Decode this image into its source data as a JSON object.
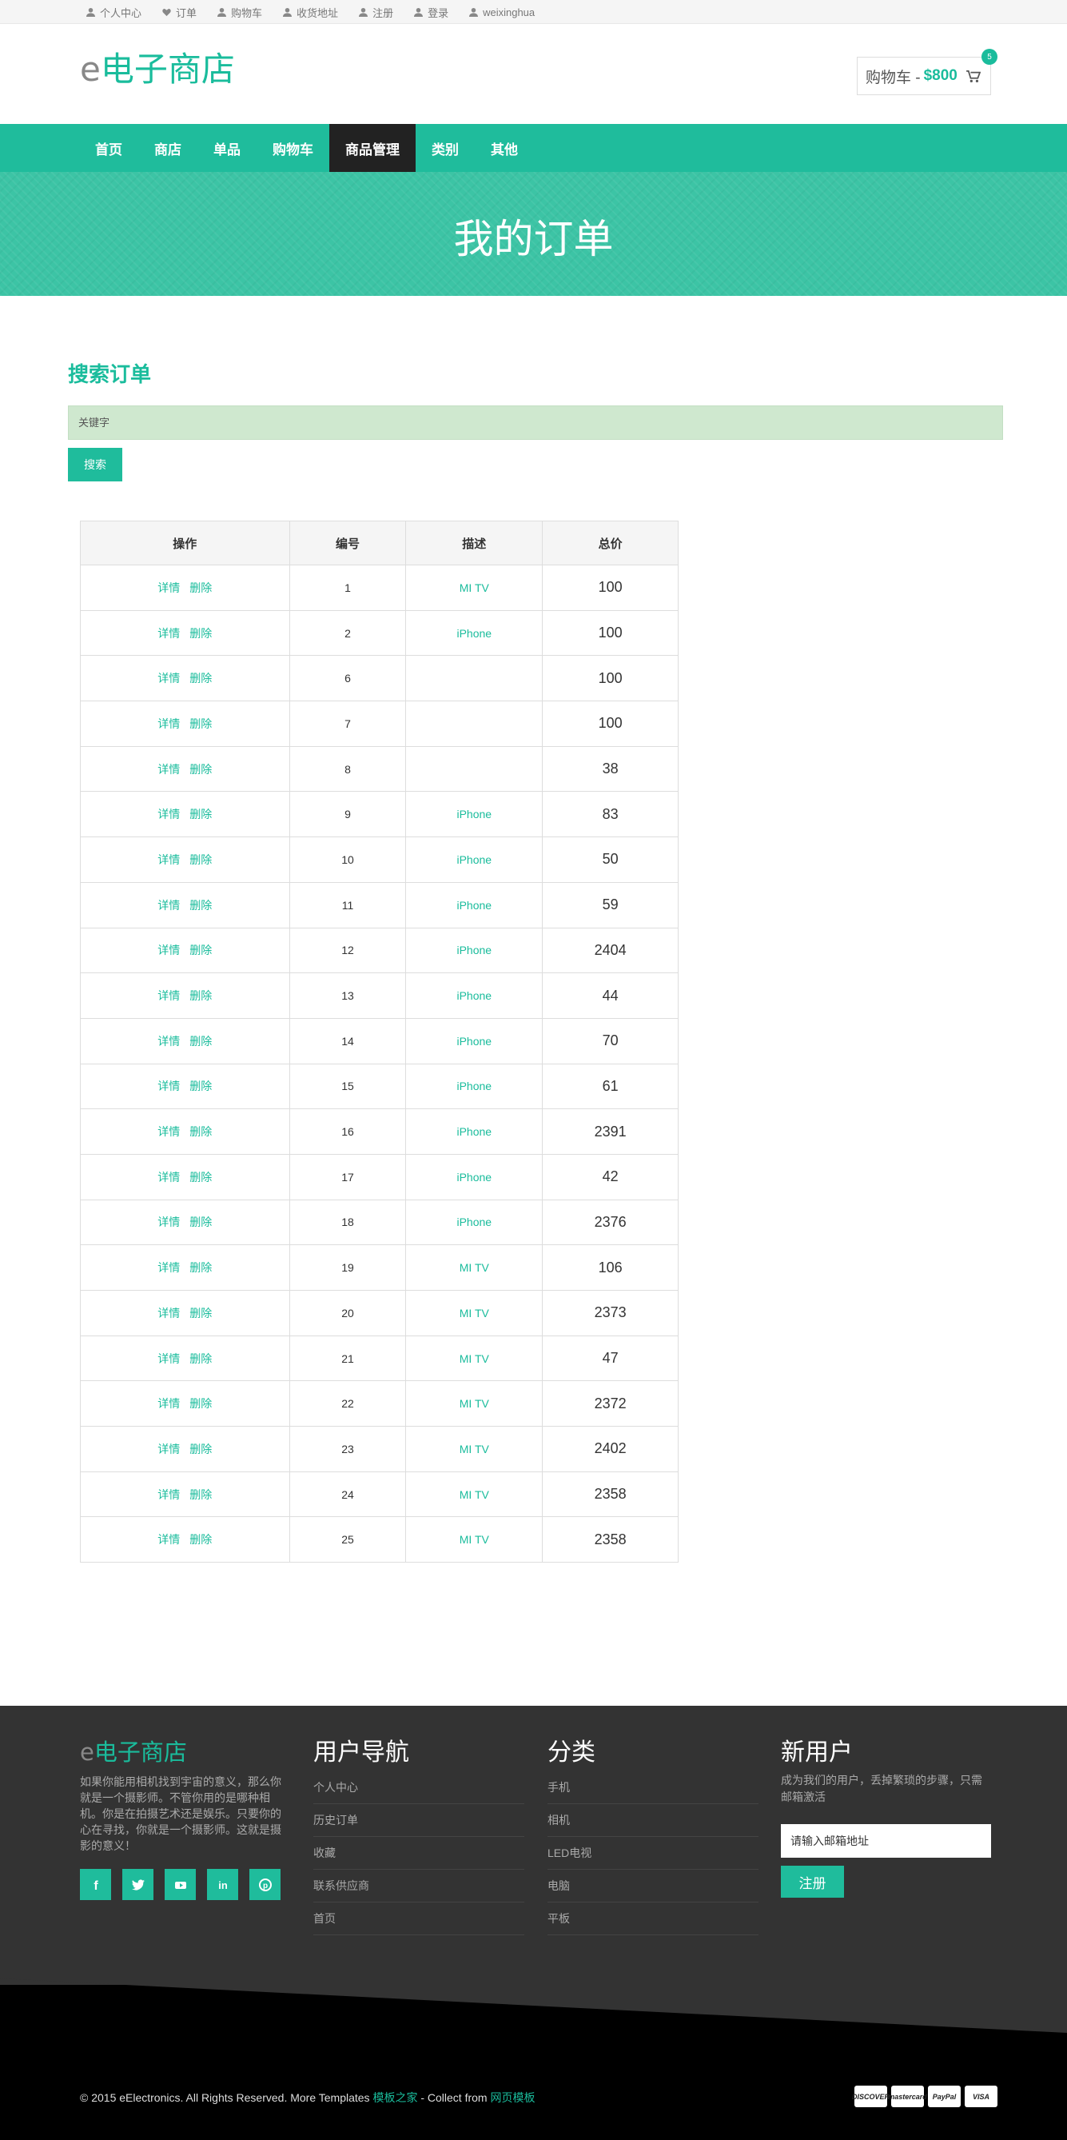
{
  "topbar": {
    "items": [
      {
        "label": "个人中心",
        "icon": "user-icon"
      },
      {
        "label": "订单",
        "icon": "heart-icon"
      },
      {
        "label": "购物车",
        "icon": "user-icon"
      },
      {
        "label": "收货地址",
        "icon": "user-icon"
      },
      {
        "label": "注册",
        "icon": "user-icon"
      },
      {
        "label": "登录",
        "icon": "user-icon"
      },
      {
        "label": "weixinghua",
        "icon": "user-icon"
      }
    ]
  },
  "header": {
    "logo_e": "e",
    "logo_text": "电子商店",
    "cart_label": "购物车 -",
    "cart_amount": "$800",
    "cart_count": "5"
  },
  "nav": {
    "items": [
      "首页",
      "商店",
      "单品",
      "购物车",
      "商品管理",
      "类别",
      "其他"
    ],
    "active": "商品管理"
  },
  "banner": {
    "title": "我的订单"
  },
  "search": {
    "title": "搜索订单",
    "placeholder": "关键字",
    "button": "搜索"
  },
  "table": {
    "headers": [
      "操作",
      "编号",
      "描述",
      "总价"
    ],
    "detail_label": "详情",
    "delete_label": "删除",
    "rows": [
      {
        "id": "1",
        "desc": "MI TV",
        "total": "100"
      },
      {
        "id": "2",
        "desc": "iPhone",
        "total": "100"
      },
      {
        "id": "6",
        "desc": "",
        "total": "100"
      },
      {
        "id": "7",
        "desc": "",
        "total": "100"
      },
      {
        "id": "8",
        "desc": "",
        "total": "38"
      },
      {
        "id": "9",
        "desc": "iPhone",
        "total": "83"
      },
      {
        "id": "10",
        "desc": "iPhone",
        "total": "50"
      },
      {
        "id": "11",
        "desc": "iPhone",
        "total": "59"
      },
      {
        "id": "12",
        "desc": "iPhone",
        "total": "2404"
      },
      {
        "id": "13",
        "desc": "iPhone",
        "total": "44"
      },
      {
        "id": "14",
        "desc": "iPhone",
        "total": "70"
      },
      {
        "id": "15",
        "desc": "iPhone",
        "total": "61"
      },
      {
        "id": "16",
        "desc": "iPhone",
        "total": "2391"
      },
      {
        "id": "17",
        "desc": "iPhone",
        "total": "42"
      },
      {
        "id": "18",
        "desc": "iPhone",
        "total": "2376"
      },
      {
        "id": "19",
        "desc": "MI TV",
        "total": "106"
      },
      {
        "id": "20",
        "desc": "MI TV",
        "total": "2373"
      },
      {
        "id": "21",
        "desc": "MI TV",
        "total": "47"
      },
      {
        "id": "22",
        "desc": "MI TV",
        "total": "2372"
      },
      {
        "id": "23",
        "desc": "MI TV",
        "total": "2402"
      },
      {
        "id": "24",
        "desc": "MI TV",
        "total": "2358"
      },
      {
        "id": "25",
        "desc": "MI TV",
        "total": "2358"
      }
    ]
  },
  "footer": {
    "logo_e": "e",
    "logo_text": "电子商店",
    "description": "如果你能用相机找到宇宙的意义，那么你就是一个摄影师。不管你用的是哪种相机。你是在拍摄艺术还是娱乐。只要你的心在寻找，你就是一个摄影师。这就是摄影的意义！",
    "socials": [
      "facebook-icon",
      "twitter-icon",
      "youtube-icon",
      "linkedin-icon",
      "pinterest-icon"
    ],
    "nav_title": "用户导航",
    "nav_items": [
      "个人中心",
      "历史订单",
      "收藏",
      "联系供应商",
      "首页"
    ],
    "cat_title": "分类",
    "cat_items": [
      "手机",
      "相机",
      "LED电视",
      "电脑",
      "平板"
    ],
    "news_title": "新用户",
    "news_desc": "成为我们的用户，丢掉繁琐的步骤，只需邮箱激活",
    "email_placeholder": "请输入邮箱地址",
    "register_button": "注册",
    "copyright_prefix": "© 2015 eElectronics. All Rights Reserved. More Templates ",
    "copyright_link1": "模板之家",
    "copyright_mid": " - Collect from ",
    "copyright_link2": "网页模板",
    "cards": [
      "DISCOVER",
      "mastercard",
      "PayPal",
      "VISA"
    ]
  },
  "colors": {
    "accent": "#1abc9c",
    "nav_active": "#222222",
    "footer_bg": "#333333",
    "search_bg": "#cfe8cf"
  }
}
